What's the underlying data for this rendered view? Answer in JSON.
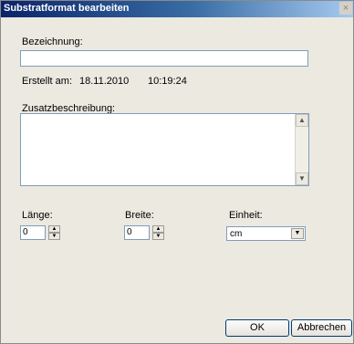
{
  "window": {
    "title": "Substratformat bearbeiten",
    "close_glyph": "×"
  },
  "form": {
    "bezeichnung_label": "Bezeichnung:",
    "bezeichnung_value": "",
    "erstellt_label": "Erstellt am:",
    "erstellt_date": "18.11.2010",
    "erstellt_time": "10:19:24",
    "zusatz_label": "Zusatzbeschreibung:",
    "zusatz_value": "",
    "laenge_label": "Länge:",
    "laenge_value": "0",
    "breite_label": "Breite:",
    "breite_value": "0",
    "einheit_label": "Einheit:",
    "einheit_value": "cm"
  },
  "buttons": {
    "ok": "OK",
    "cancel": "Abbrechen"
  },
  "icons": {
    "scroll_up": "scroll-up-arrow-icon",
    "scroll_down": "scroll-down-arrow-icon",
    "dropdown": "chevron-down-icon",
    "spin_up": "spin-up-icon",
    "spin_down": "spin-down-icon"
  }
}
